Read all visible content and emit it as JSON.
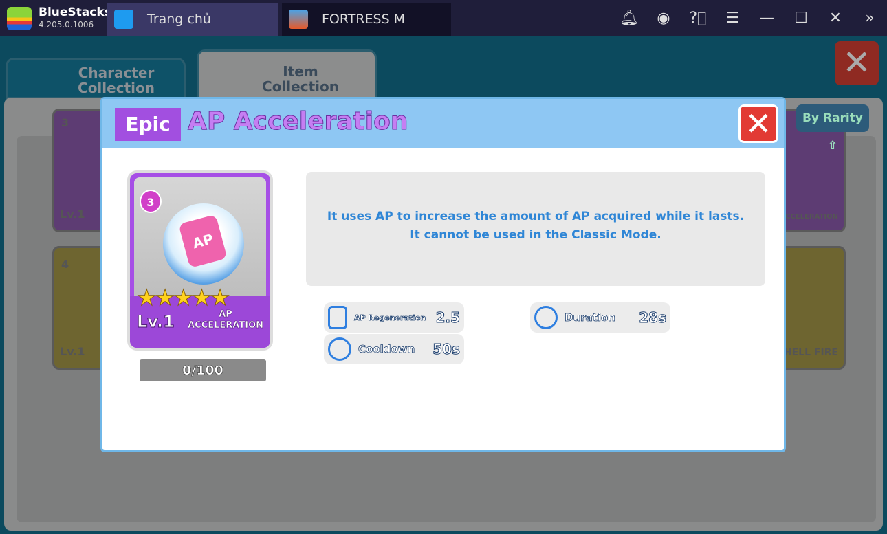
{
  "app": {
    "name": "BlueStacks",
    "version": "4.205.0.1006"
  },
  "tabs": [
    {
      "label": "Trang chủ"
    },
    {
      "label": "FORTRESS M"
    }
  ],
  "controls": [
    "bell-icon",
    "account-icon",
    "help-icon",
    "menu-icon",
    "minimize-icon",
    "maximize-icon",
    "close-icon",
    "expand-icon"
  ],
  "game": {
    "tabs": [
      {
        "label": "Character Collection"
      },
      {
        "label": "Item Collection"
      }
    ],
    "sort_label": "By Rarity",
    "bg_cards": [
      {
        "level": "3",
        "lv": "Lv.1"
      },
      {
        "level": "4",
        "lv": "Lv.1"
      },
      {
        "name": "AP ACCELERATION"
      },
      {
        "name": "SHELL FIRE"
      }
    ]
  },
  "modal": {
    "rarity": "Epic",
    "title": "AP Acceleration",
    "card": {
      "cost": "3",
      "can_text": "AP",
      "stars": 5,
      "level": "Lv.1",
      "name_line1": "AP",
      "name_line2": "ACCELERATION",
      "progress": "0/100"
    },
    "description_line1": "It uses AP to increase the amount of AP acquired while it lasts.",
    "description_line2": "It cannot be used in the Classic Mode.",
    "stats": [
      {
        "label": "AP Regeneration",
        "value": "2.5",
        "icon": "battery-plus-icon"
      },
      {
        "label": "Cooldown",
        "value": "50s",
        "icon": "clock-cycle-icon"
      },
      {
        "label": "Duration",
        "value": "28s",
        "icon": "clock-cycle-icon"
      }
    ]
  },
  "colors": {
    "epic": "#a24fe0",
    "header": "#8ec7f3",
    "desc_text": "#2f86d6",
    "close": "#e23a34"
  }
}
